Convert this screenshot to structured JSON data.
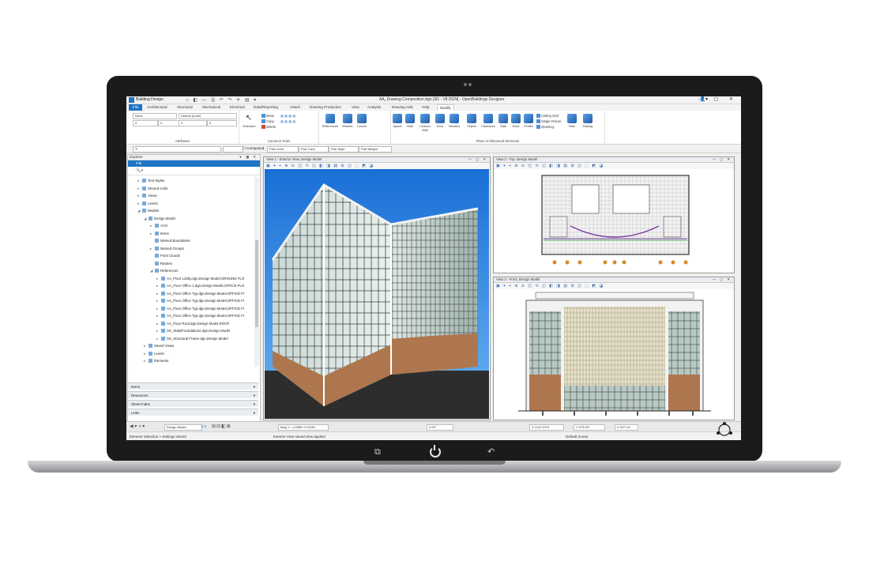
{
  "window": {
    "app_name": "Building Design",
    "doc_title": "AA_Drawing Composition.dgn [3D - V8 DGN] - OpenBuildings Designer",
    "quick_access": "⌂ ◧ ▭ 🖫 ↶ ↷ ✈ ▤ ▾",
    "window_controls": "— ▢ ✕"
  },
  "ribbon_tabs": [
    "File",
    "Architectural",
    "Structural",
    "Mechanical",
    "Electrical",
    "Data/Reporting",
    "Attach",
    "Drawing Production",
    "View",
    "Analysis",
    "Drawing Aids",
    "Help",
    "Modify"
  ],
  "search_placeholder": "Search Ribbon (F4)",
  "ribbon": {
    "attributes": {
      "level": "None",
      "template": "Default (none)",
      "val1": "0",
      "val2": "0",
      "val3": "0",
      "val4": "0",
      "label": "Attributes"
    },
    "selection": "Selection",
    "common_tools": {
      "move": "Move",
      "copy": "Copy",
      "delete": "Delete",
      "references": "References",
      "models": "Models",
      "levels": "Levels",
      "label": "Common Tools"
    },
    "arch_elements": {
      "space": "Space",
      "wall": "Wall",
      "curtain_wall": "Custom Wall",
      "door": "Door",
      "window": "Window",
      "object": "Object",
      "casework": "Casework",
      "slab": "Slab",
      "roof": "Roof",
      "profile": "Profile",
      "ceiling_grid": "Ceiling Grid",
      "single_fixture": "Single Fixture",
      "opening": "Opening",
      "stair": "Stair",
      "railing": "Railing",
      "label": "Place Architectural Elements"
    }
  },
  "attr_bar": {
    "compound": "Compound",
    "part_level": "Part Level",
    "part_color": "Part Color",
    "part_style": "Part Style",
    "part_weight": "Part Weight"
  },
  "explorer": {
    "title": "Explorer",
    "file_tab": "File",
    "tree": [
      {
        "label": "Text Styles",
        "depth": 1,
        "arrow": "▸"
      },
      {
        "label": "Shared Cells",
        "depth": 1,
        "arrow": "▸"
      },
      {
        "label": "Views",
        "depth": 1,
        "arrow": "▸"
      },
      {
        "label": "Levels",
        "depth": 1,
        "arrow": "▸"
      },
      {
        "label": "Models",
        "depth": 1,
        "arrow": "◢"
      },
      {
        "label": "Design Model",
        "depth": 2,
        "arrow": "◢"
      },
      {
        "label": "ACS",
        "depth": 3,
        "arrow": "▸"
      },
      {
        "label": "Items",
        "depth": 3,
        "arrow": "▸"
      },
      {
        "label": "Named Boundaries",
        "depth": 3,
        "arrow": ""
      },
      {
        "label": "Named Groups",
        "depth": 3,
        "arrow": "▸"
      },
      {
        "label": "Point Clouds",
        "depth": 3,
        "arrow": ""
      },
      {
        "label": "Rasters",
        "depth": 3,
        "arrow": ""
      },
      {
        "label": "References",
        "depth": 3,
        "arrow": "◢"
      },
      {
        "label": "AA_Floor Lobby.dgn,Design Model,GROUND FLO",
        "depth": 4,
        "arrow": "▸"
      },
      {
        "label": "AA_Floor Office 1.dgn,Design Model,OFFICE FLO",
        "depth": 4,
        "arrow": "▸"
      },
      {
        "label": "AA_Floor Office Typ.dgn,Design Model,OFFICE FI",
        "depth": 4,
        "arrow": "▸"
      },
      {
        "label": "AA_Floor Office Typ.dgn,Design Model,OFFICE FI",
        "depth": 4,
        "arrow": "▸"
      },
      {
        "label": "AA_Floor Office Typ.dgn,Design Model,OFFICE FI",
        "depth": 4,
        "arrow": "▸"
      },
      {
        "label": "AA_Floor Office Typ.dgn,Design Model,OFFICE FI",
        "depth": 4,
        "arrow": "▸"
      },
      {
        "label": "AA_Floor Roof.dgn,Design Model,ROOF",
        "depth": 4,
        "arrow": "▸"
      },
      {
        "label": "SS_SlabsFoundations.dgn,Design Model",
        "depth": 4,
        "arrow": "▸"
      },
      {
        "label": "SS_Structural Frame.dgn,Design Model",
        "depth": 4,
        "arrow": "▸"
      },
      {
        "label": "Saved Views",
        "depth": 2,
        "arrow": "▸"
      },
      {
        "label": "Levels",
        "depth": 2,
        "arrow": "▸"
      },
      {
        "label": "Elements",
        "depth": 2,
        "arrow": "▸"
      }
    ],
    "panels": [
      "Items",
      "Resources",
      "Sheet Index",
      "Links"
    ]
  },
  "views": {
    "v1": "View 1 - Exterior View, Design Model",
    "v2": "View 2 - Top, Design Model",
    "v3": "View 3 - Front, Design Model",
    "tool_icons": "▣ ▾ ⌖ ⊕ ⊖ ◰ ⟲ ◱ ◧ ◨ ▤ ⊞ ◫ ⬚ ◩ ◪",
    "ctl": "— ▢ ✕"
  },
  "status": {
    "model": "Design Model",
    "scale": "1:1",
    "level": "Bldg 1 > LOBBY FLOOR",
    "angle": "0.00°",
    "x": "X 1122.5'5.5",
    "y": "Y 273.5'6",
    "z": "Z 947.1/4",
    "default": "Default (none)"
  },
  "messages": {
    "left": "Element Selection > Settings Saved",
    "right": "Exterior View saved view applied"
  },
  "colors": {
    "accent": "#1f74c4",
    "sky": "#1c7ee0",
    "brick": "#b07850"
  },
  "icons": [
    "recent-apps-icon",
    "power-icon",
    "back-icon",
    "user-icon",
    "folder-icon",
    "search-icon"
  ]
}
